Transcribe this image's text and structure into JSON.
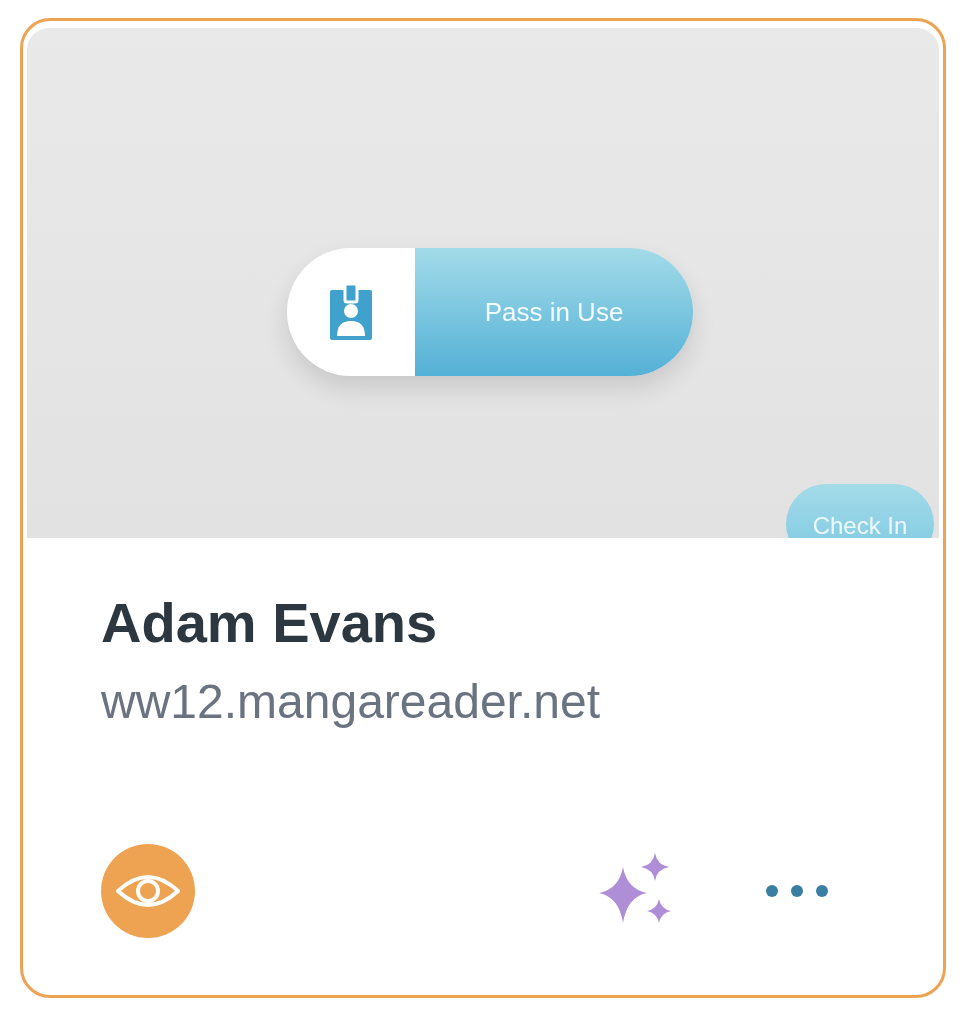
{
  "preview": {
    "pass_button": {
      "label": "Pass in Use"
    },
    "check_in_button": {
      "label": "Check In"
    }
  },
  "title": "Adam Evans",
  "subtitle": "ww12.mangareader.net"
}
